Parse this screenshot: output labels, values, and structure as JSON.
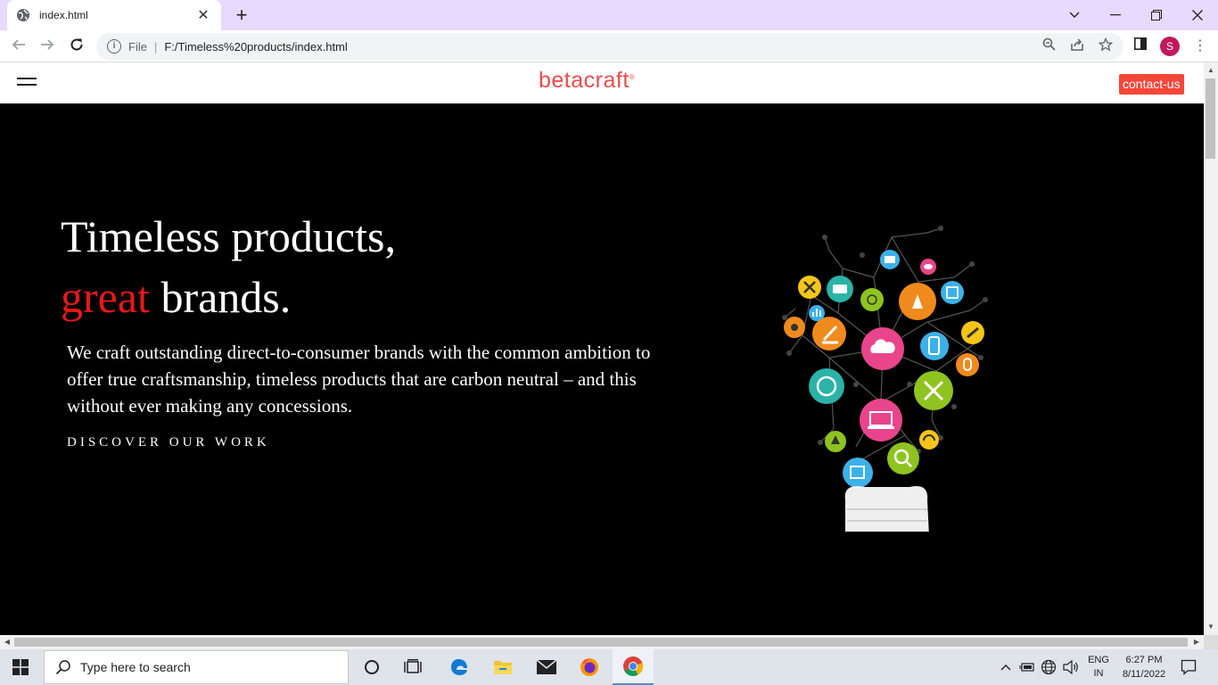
{
  "browser": {
    "tab_title": "index.html",
    "url_scheme": "File",
    "url": "F:/Timeless%20products/index.html",
    "profile_initial": "S"
  },
  "site": {
    "logo_beta": "beta",
    "logo_craft": "craft",
    "logo_mark": "®",
    "contact_label": "contact-us"
  },
  "hero": {
    "title_line1": "Timeless products,",
    "title_accent": "great",
    "title_line2_rest": " brands.",
    "description": "We craft outstanding direct-to-consumer brands with the common ambition to offer true craftsmanship, timeless products that are carbon neutral – and this without ever making any concessions.",
    "cta": "DISCOVER OUR WORK"
  },
  "taskbar": {
    "search_placeholder": "Type here to search",
    "lang_line1": "ENG",
    "lang_line2": "IN",
    "time": "6:27 PM",
    "date": "8/11/2022"
  },
  "colors": {
    "accent_red": "#e81818",
    "brand": "#e84c4c",
    "contact_bg": "#f4473a",
    "tab_strip": "#e8d9ff"
  },
  "icons": [
    "globe-icon",
    "close-icon",
    "plus-icon",
    "back-icon",
    "forward-icon",
    "reload-icon",
    "info-icon",
    "zoom-icon",
    "share-icon",
    "star-icon",
    "sidepanel-icon",
    "windows-icon",
    "search-icon",
    "cortana-icon",
    "taskview-icon",
    "edge-icon",
    "explorer-icon",
    "mail-icon",
    "firefox-icon",
    "chrome-icon",
    "chevron-up-icon",
    "battery-icon",
    "network-icon",
    "volume-icon",
    "notification-icon"
  ]
}
